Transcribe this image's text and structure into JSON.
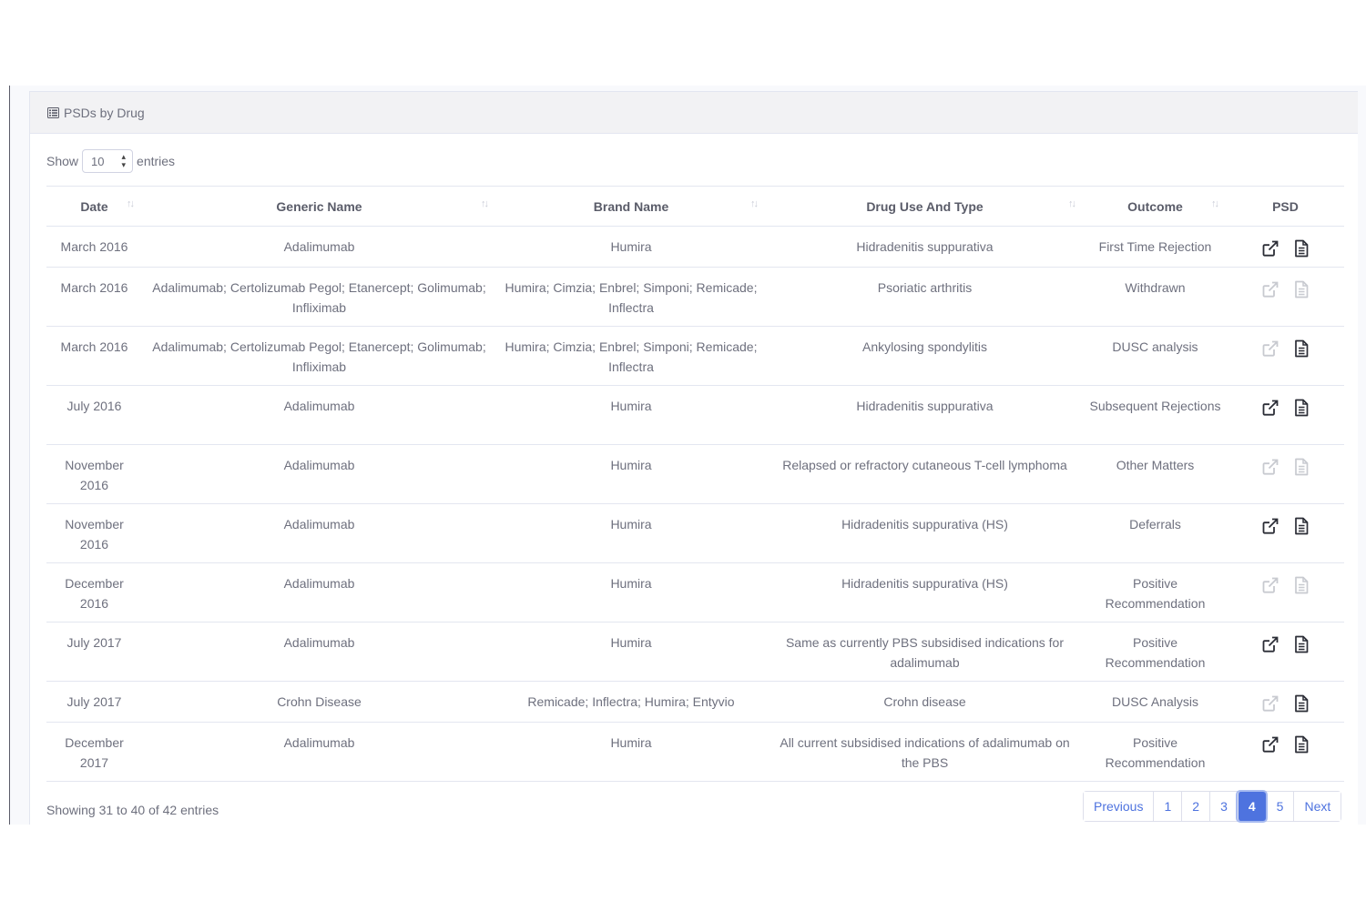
{
  "card": {
    "title": "PSDs by Drug",
    "title_icon": "list-alt-icon"
  },
  "length_menu": {
    "show_label": "Show",
    "selected": "10",
    "entries_label": "entries"
  },
  "table": {
    "columns": [
      "Date",
      "Generic Name",
      "Brand Name",
      "Drug Use And Type",
      "Outcome",
      "PSD"
    ],
    "rows": [
      {
        "date": "March 2016",
        "generic": "Adalimumab",
        "brand": "Humira",
        "use": "Hidradenitis suppurativa",
        "outcome": "First Time Rejection",
        "link_active": true,
        "doc_active": true
      },
      {
        "date": "March 2016",
        "generic": "Adalimumab; Certolizumab Pegol; Etanercept; Golimumab; Infliximab",
        "brand": "Humira; Cimzia; Enbrel; Simponi; Remicade; Inflectra",
        "use": "Psoriatic arthritis",
        "outcome": "Withdrawn",
        "link_active": false,
        "doc_active": false
      },
      {
        "date": "March 2016",
        "generic": "Adalimumab; Certolizumab Pegol; Etanercept; Golimumab; Infliximab",
        "brand": "Humira; Cimzia; Enbrel; Simponi; Remicade; Inflectra",
        "use": "Ankylosing spondylitis",
        "outcome": "DUSC analysis",
        "link_active": false,
        "doc_active": true
      },
      {
        "date": "July 2016",
        "generic": "Adalimumab",
        "brand": "Humira",
        "use": "Hidradenitis suppurativa",
        "outcome": "Subsequent Rejections",
        "link_active": true,
        "doc_active": true
      },
      {
        "date": "November 2016",
        "generic": "Adalimumab",
        "brand": "Humira",
        "use": "Relapsed or refractory cutaneous T-cell lymphoma",
        "outcome": "Other Matters",
        "link_active": false,
        "doc_active": false
      },
      {
        "date": "November 2016",
        "generic": "Adalimumab",
        "brand": "Humira",
        "use": "Hidradenitis suppurativa (HS)",
        "outcome": "Deferrals",
        "link_active": true,
        "doc_active": true
      },
      {
        "date": "December 2016",
        "generic": "Adalimumab",
        "brand": "Humira",
        "use": "Hidradenitis suppurativa (HS)",
        "outcome": "Positive Recommendation",
        "link_active": false,
        "doc_active": false
      },
      {
        "date": "July 2017",
        "generic": "Adalimumab",
        "brand": "Humira",
        "use": "Same as currently PBS subsidised indications for adalimumab",
        "outcome": "Positive Recommendation",
        "link_active": true,
        "doc_active": true
      },
      {
        "date": "July 2017",
        "generic": "Crohn Disease",
        "brand": "Remicade; Inflectra; Humira; Entyvio",
        "use": "Crohn disease",
        "outcome": "DUSC Analysis",
        "link_active": false,
        "doc_active": true
      },
      {
        "date": "December 2017",
        "generic": "Adalimumab",
        "brand": "Humira",
        "use": "All current subsidised indications of adalimumab on the PBS",
        "outcome": "Positive Recommendation",
        "link_active": true,
        "doc_active": true
      }
    ]
  },
  "footer": {
    "info": "Showing 31 to 40 of 42 entries"
  },
  "pagination": {
    "previous": "Previous",
    "pages": [
      "1",
      "2",
      "3",
      "4",
      "5"
    ],
    "current": "4",
    "next": "Next"
  },
  "colors": {
    "primary": "#4e73df",
    "icon_active": "#2b2d36",
    "icon_inactive": "#c8cad0"
  }
}
